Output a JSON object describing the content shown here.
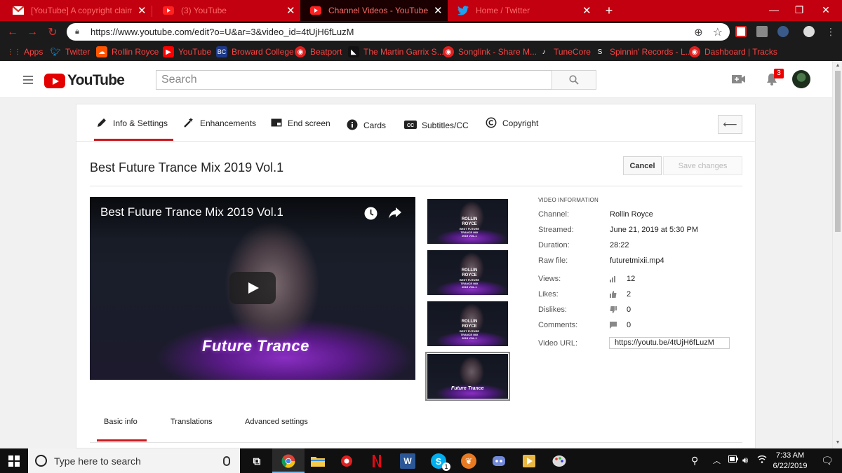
{
  "browser": {
    "tabs": [
      {
        "title": "[YouTube] A copyright claim was",
        "icon": "gmail-icon"
      },
      {
        "title": "(3) YouTube",
        "icon": "youtube-icon"
      },
      {
        "title": "Channel Videos - YouTube Studio",
        "icon": "youtube-icon"
      },
      {
        "title": "Home / Twitter",
        "icon": "twitter-icon"
      }
    ],
    "window_controls": {
      "minimize": "—",
      "restore": "❐",
      "close": "✕"
    },
    "url": "https://www.youtube.com/edit?o=U&ar=3&video_id=4tUjH6fLuzM",
    "bookmarks": [
      {
        "label": "Apps"
      },
      {
        "label": "Twitter"
      },
      {
        "label": "Rollin Royce"
      },
      {
        "label": "YouTube"
      },
      {
        "label": "Broward College"
      },
      {
        "label": "Beatport"
      },
      {
        "label": "The Martin Garrix S..."
      },
      {
        "label": "Songlink - Share M..."
      },
      {
        "label": "TuneCore"
      },
      {
        "label": "Spinnin' Records - L..."
      },
      {
        "label": "Dashboard | Tracks"
      }
    ]
  },
  "youtube": {
    "logo_text": "YouTube",
    "search_placeholder": "Search",
    "notification_count": "3"
  },
  "editor": {
    "tabs": [
      {
        "label": "Info & Settings",
        "icon": "pencil-icon",
        "active": true
      },
      {
        "label": "Enhancements",
        "icon": "magic-wand-icon"
      },
      {
        "label": "End screen",
        "icon": "end-screen-icon"
      },
      {
        "label": "Cards",
        "icon": "info-icon"
      },
      {
        "label": "Subtitles/CC",
        "icon": "cc-icon"
      },
      {
        "label": "Copyright",
        "icon": "copyright-icon"
      }
    ],
    "video_title": "Best Future Trance Mix 2019 Vol.1",
    "cancel_label": "Cancel",
    "save_label": "Save changes",
    "player": {
      "title": "Best Future Trance Mix 2019 Vol.1",
      "brand_text": "Future Trance"
    },
    "thumbnails": [
      {
        "line1": "ROLLIN",
        "line2": "ROYCE",
        "line3": "BEST FUTURE TRANCE MIX",
        "line4": "2019 VOL.1"
      },
      {
        "line1": "ROLLIN",
        "line2": "ROYCE",
        "line3": "BEST FUTURE TRANCE MIX",
        "line4": "2019 VOL.1"
      },
      {
        "line1": "ROLLIN",
        "line2": "ROYCE",
        "line3": "BEST FUTURE TRANCE MIX",
        "line4": "2019 VOL.1"
      },
      {
        "brand": "Future Trance",
        "selected": true
      }
    ],
    "video_information": {
      "heading": "VIDEO INFORMATION",
      "channel_label": "Channel:",
      "channel": "Rollin Royce",
      "streamed_label": "Streamed:",
      "streamed": "June 21, 2019 at 5:30 PM",
      "duration_label": "Duration:",
      "duration": "28:22",
      "raw_file_label": "Raw file:",
      "raw_file": "futuretmixii.mp4",
      "views_label": "Views:",
      "views": "12",
      "likes_label": "Likes:",
      "likes": "2",
      "dislikes_label": "Dislikes:",
      "dislikes": "0",
      "comments_label": "Comments:",
      "comments": "0",
      "url_label": "Video URL:",
      "url": "https://youtu.be/4tUjH6fLuzM"
    },
    "bottom_tabs": [
      {
        "label": "Basic info",
        "active": true
      },
      {
        "label": "Translations"
      },
      {
        "label": "Advanced settings"
      }
    ]
  },
  "taskbar": {
    "search_placeholder": "Type here to search",
    "time": "7:33 AM",
    "date": "6/22/2019",
    "skype_badge": "1"
  }
}
